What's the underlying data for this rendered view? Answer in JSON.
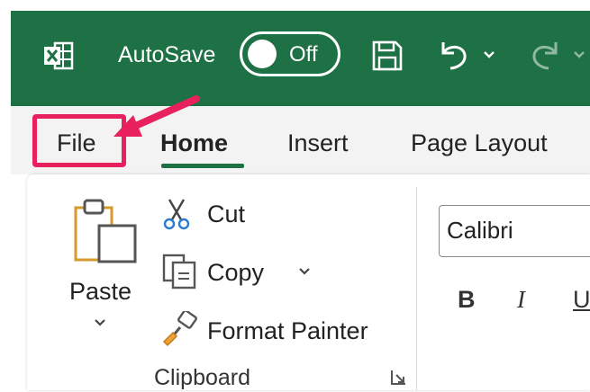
{
  "title_bar": {
    "app_icon": "excel-icon",
    "autosave_label": "AutoSave",
    "autosave_state": "Off",
    "save_icon": "save-icon",
    "undo_icon": "undo-icon",
    "redo_icon": "redo-icon",
    "background": "#1e7145"
  },
  "tabs": {
    "file": "File",
    "home": "Home",
    "insert": "Insert",
    "page_layout": "Page Layout"
  },
  "annotation": {
    "highlight_color": "#e8205e"
  },
  "ribbon": {
    "clipboard": {
      "paste": "Paste",
      "cut": "Cut",
      "copy": "Copy",
      "format_painter": "Format Painter",
      "group_label": "Clipboard"
    },
    "font": {
      "font_name": "Calibri",
      "bold": "B",
      "italic": "I",
      "underline": "U"
    }
  }
}
